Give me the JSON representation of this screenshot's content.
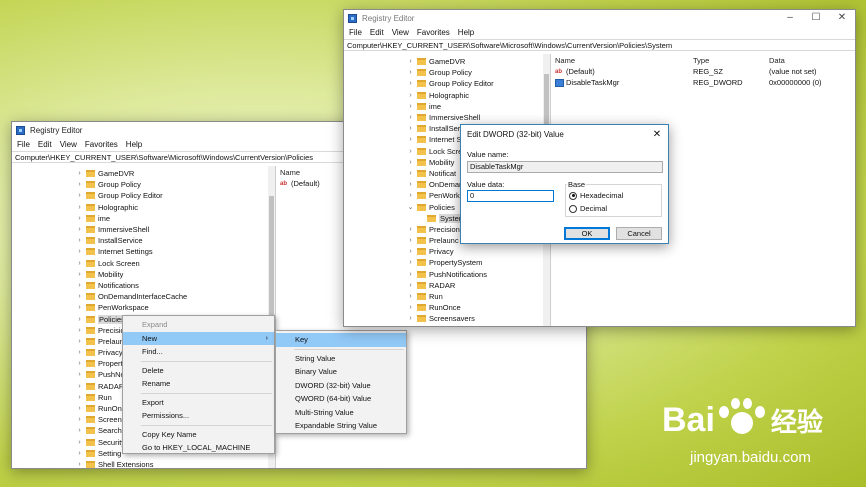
{
  "back_window": {
    "title": "Registry Editor",
    "menu": [
      "File",
      "Edit",
      "View",
      "Favorites",
      "Help"
    ],
    "address": "Computer\\HKEY_CURRENT_USER\\Software\\Microsoft\\Windows\\CurrentVersion\\Policies",
    "tree": [
      "GameDVR",
      "Group Policy",
      "Group Policy Editor",
      "Holographic",
      "ime",
      "ImmersiveShell",
      "InstallService",
      "Internet Settings",
      "Lock Screen",
      "Mobility",
      "Notifications",
      "OnDemandInterfaceCache",
      "PenWorkspace",
      "Policies",
      "Precisio",
      "Prelaun",
      "Privacy",
      "Propert",
      "PushNo",
      "RADAR",
      "Run",
      "RunOn",
      "Screens",
      "Search",
      "Security",
      "Setting",
      "Shell Extensions"
    ],
    "values_header": "Name",
    "values": [
      "(Default)"
    ]
  },
  "context_menu": {
    "items": [
      "Expand",
      "New",
      "Find...",
      "Delete",
      "Rename",
      "Export",
      "Permissions...",
      "Copy Key Name",
      "Go to HKEY_LOCAL_MACHINE"
    ]
  },
  "submenu": {
    "items": [
      "Key",
      "String Value",
      "Binary Value",
      "DWORD (32-bit) Value",
      "QWORD (64-bit) Value",
      "Multi-String Value",
      "Expandable String Value"
    ]
  },
  "front_window": {
    "title": "Registry Editor",
    "menu": [
      "File",
      "Edit",
      "View",
      "Favorites",
      "Help"
    ],
    "address": "Computer\\HKEY_CURRENT_USER\\Software\\Microsoft\\Windows\\CurrentVersion\\Policies\\System",
    "tree": [
      "GameDVR",
      "Group Policy",
      "Group Policy Editor",
      "Holographic",
      "ime",
      "ImmersiveShell",
      "InstallSer",
      "Internet S",
      "Lock Scre",
      "Mobility",
      "Notificat",
      "OnDemar",
      "PenWork",
      "Policies",
      "System",
      "Precision",
      "Prelaunc",
      "Privacy",
      "PropertySystem",
      "PushNotifications",
      "RADAR",
      "Run",
      "RunOnce",
      "Screensavers"
    ],
    "columns": [
      "Name",
      "Type",
      "Data"
    ],
    "rows": [
      {
        "name": "(Default)",
        "type": "REG_SZ",
        "data": "(value not set)"
      },
      {
        "name": "DisableTaskMgr",
        "type": "REG_DWORD",
        "data": "0x00000000 (0)"
      }
    ]
  },
  "dialog": {
    "title": "Edit DWORD (32-bit) Value",
    "value_name_label": "Value name:",
    "value_name": "DisableTaskMgr",
    "value_data_label": "Value data:",
    "value_data": "0",
    "base_label": "Base",
    "hex_label": "Hexadecimal",
    "dec_label": "Decimal",
    "ok": "OK",
    "cancel": "Cancel"
  },
  "watermark": {
    "bai": "Bai",
    "du": "du",
    "cn": "经验",
    "url": "jingyan.baidu.com"
  }
}
